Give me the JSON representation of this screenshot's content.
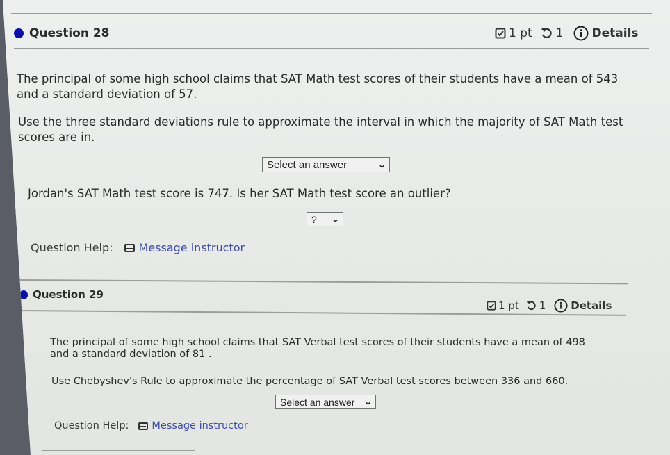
{
  "questions": [
    {
      "title": "Question 28",
      "points": "1 pt",
      "attempts": "1",
      "details_label": "Details",
      "paragraphs": [
        "The principal of some high school claims that SAT Math test scores of their students have a mean of 543 and a standard deviation of 57.",
        "Use the three standard deviations rule to approximate the interval in which the majority of SAT Math test scores are in.",
        "Jordan's SAT Math test score is 747. Is her SAT Math test score an outlier?"
      ],
      "select_1": "Select an answer",
      "select_2": "?",
      "help_label": "Question Help:",
      "message_label": "Message instructor"
    },
    {
      "title": "Question 29",
      "points": "1 pt",
      "attempts": "1",
      "details_label": "Details",
      "paragraphs": [
        "The principal of some high school claims that SAT Verbal test scores of their students have a mean of 498 and a standard deviation of 81 .",
        "Use Chebyshev's Rule to approximate the percentage of SAT Verbal test scores between 336 and 660."
      ],
      "select_1": "Select an answer",
      "help_label": "Question Help:",
      "message_label": "Message instructor"
    }
  ],
  "icons": {
    "status_dot": "filled-circle",
    "points": "checkbox-icon",
    "attempts": "retry-icon",
    "details": "info-icon",
    "message": "envelope-icon"
  },
  "colors": {
    "status_dot": "#0a0fa8",
    "link": "#3f4ea3"
  }
}
